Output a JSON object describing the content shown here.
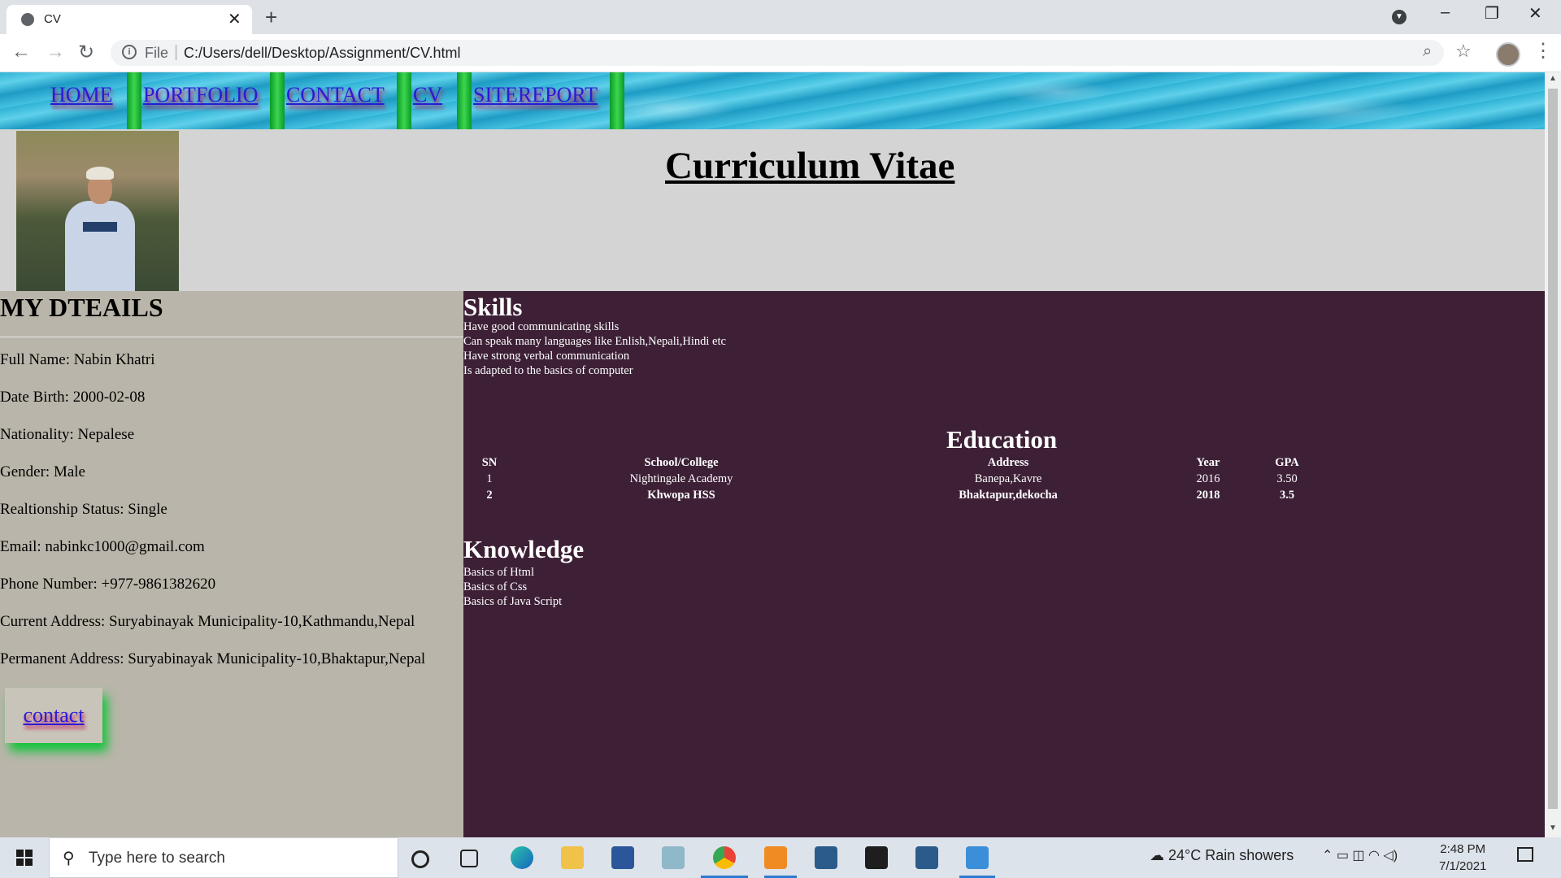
{
  "browser": {
    "tab_title": "CV",
    "tab_close": "✕",
    "new_tab": "+",
    "address_prefix": "File",
    "url": "C:/Users/dell/Desktop/Assignment/CV.html",
    "window_controls": [
      "–",
      "❐",
      "✕"
    ]
  },
  "nav": {
    "items": [
      "HOME",
      "PORTFOLIO",
      "CONTACT",
      "CV",
      "SITEREPORT"
    ]
  },
  "header": {
    "title": "Curriculum Vitae"
  },
  "details": {
    "heading": "MY DTEAILS",
    "items": [
      "Full Name: Nabin Khatri",
      "Date Birth: 2000-02-08",
      "Nationality: Nepalese",
      "Gender: Male",
      "Realtionship Status: Single",
      "Email: nabinkc1000@gmail.com",
      "Phone Number: +977-9861382620",
      "Current Address: Suryabinayak Municipality-10,Kathmandu,Nepal",
      "Permanent Address: Suryabinayak Municipality-10,Bhaktapur,Nepal"
    ],
    "contact_button": "contact"
  },
  "skills": {
    "heading": "Skills",
    "items": [
      "Have good communicating skills",
      "Can speak many languages like Enlish,Nepali,Hindi etc",
      "Have strong verbal communication",
      "Is adapted to the basics of computer"
    ]
  },
  "education": {
    "heading": "Education",
    "columns": [
      "SN",
      "School/College",
      "Address",
      "Year",
      "GPA"
    ],
    "rows": [
      [
        "1",
        "Nightingale Academy",
        "Banepa,Kavre",
        "2016",
        "3.50"
      ],
      [
        "2",
        "Khwopa HSS",
        "Bhaktapur,dekocha",
        "2018",
        "3.5"
      ]
    ]
  },
  "knowledge": {
    "heading": "Knowledge",
    "items": [
      "Basics of Html",
      "Basics of Css",
      "Basics of Java Script"
    ]
  },
  "taskbar": {
    "search_placeholder": "Type here to search",
    "weather": "24°C  Rain showers",
    "time": "2:48 PM",
    "date": "7/1/2021"
  }
}
